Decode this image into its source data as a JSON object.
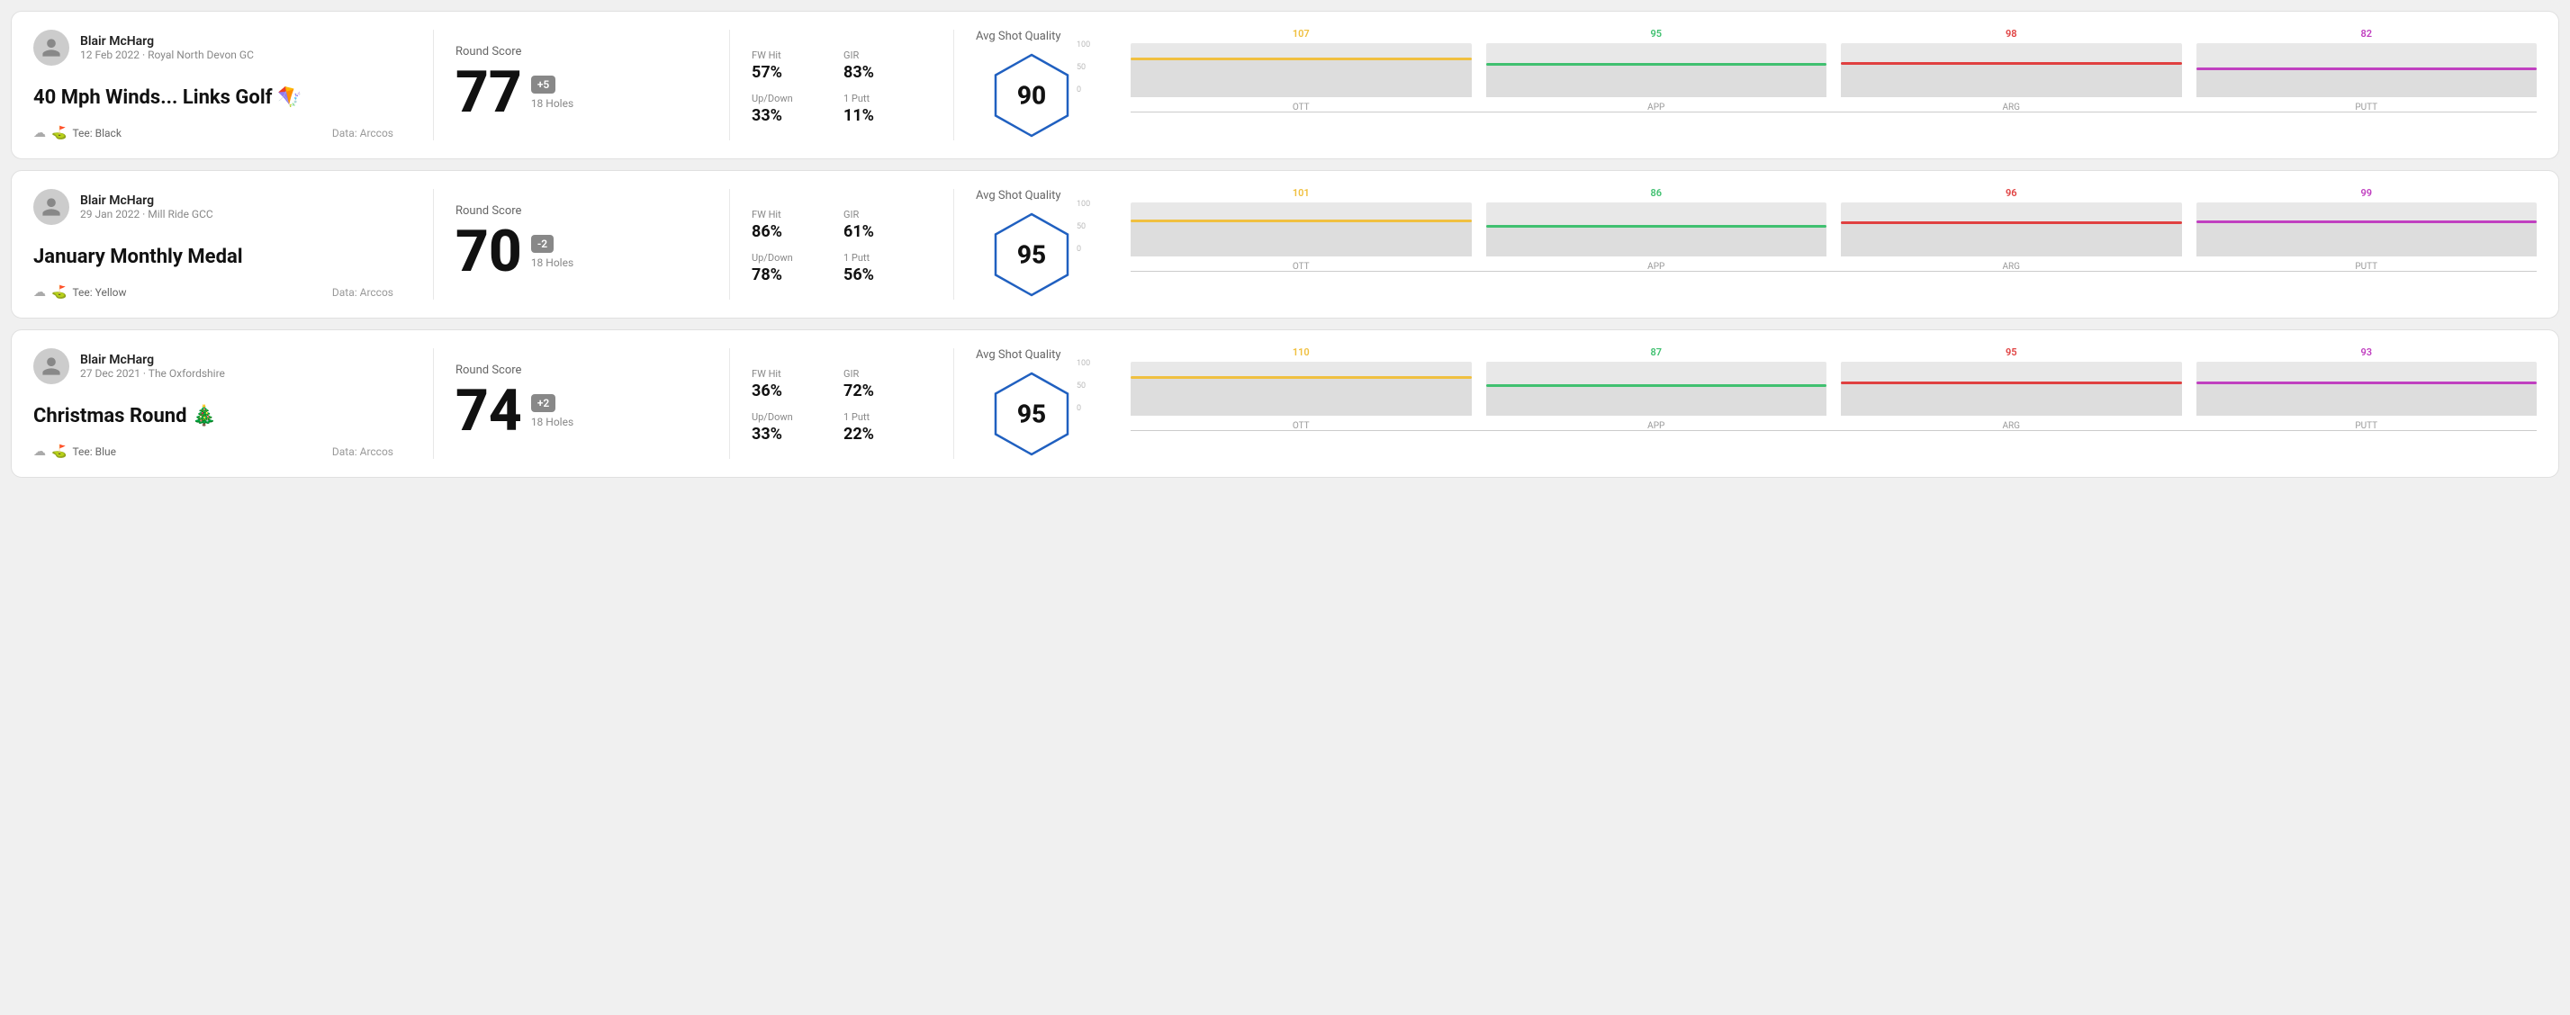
{
  "rounds": [
    {
      "id": "round-1",
      "user": {
        "name": "Blair McHarg",
        "date": "12 Feb 2022 · Royal North Devon GC"
      },
      "title": "40 Mph Winds... Links Golf 🪁",
      "tee": "Black",
      "dataSource": "Data: Arccos",
      "score": {
        "label": "Round Score",
        "value": "77",
        "badge": "+5",
        "badgeType": "positive",
        "holes": "18 Holes"
      },
      "stats": {
        "fwHitLabel": "FW Hit",
        "fwHitValue": "57%",
        "girLabel": "GIR",
        "girValue": "83%",
        "upDownLabel": "Up/Down",
        "upDownValue": "33%",
        "onePuttLabel": "1 Putt",
        "onePuttValue": "11%"
      },
      "quality": {
        "label": "Avg Shot Quality",
        "score": "90"
      },
      "chart": {
        "bars": [
          {
            "label": "OTT",
            "value": 107,
            "color": "#f0c040",
            "fillHeight": 72
          },
          {
            "label": "APP",
            "value": 95,
            "color": "#40c070",
            "fillHeight": 63
          },
          {
            "label": "ARG",
            "value": 98,
            "color": "#e04040",
            "fillHeight": 65
          },
          {
            "label": "PUTT",
            "value": 82,
            "color": "#c040c0",
            "fillHeight": 55
          }
        ],
        "yLabels": [
          "100",
          "50",
          "0"
        ]
      }
    },
    {
      "id": "round-2",
      "user": {
        "name": "Blair McHarg",
        "date": "29 Jan 2022 · Mill Ride GCC"
      },
      "title": "January Monthly Medal",
      "tee": "Yellow",
      "dataSource": "Data: Arccos",
      "score": {
        "label": "Round Score",
        "value": "70",
        "badge": "-2",
        "badgeType": "negative",
        "holes": "18 Holes"
      },
      "stats": {
        "fwHitLabel": "FW Hit",
        "fwHitValue": "86%",
        "girLabel": "GIR",
        "girValue": "61%",
        "upDownLabel": "Up/Down",
        "upDownValue": "78%",
        "onePuttLabel": "1 Putt",
        "onePuttValue": "56%"
      },
      "quality": {
        "label": "Avg Shot Quality",
        "score": "95"
      },
      "chart": {
        "bars": [
          {
            "label": "OTT",
            "value": 101,
            "color": "#f0c040",
            "fillHeight": 67
          },
          {
            "label": "APP",
            "value": 86,
            "color": "#40c070",
            "fillHeight": 57
          },
          {
            "label": "ARG",
            "value": 96,
            "color": "#e04040",
            "fillHeight": 64
          },
          {
            "label": "PUTT",
            "value": 99,
            "color": "#c040c0",
            "fillHeight": 66
          }
        ],
        "yLabels": [
          "100",
          "50",
          "0"
        ]
      }
    },
    {
      "id": "round-3",
      "user": {
        "name": "Blair McHarg",
        "date": "27 Dec 2021 · The Oxfordshire"
      },
      "title": "Christmas Round 🎄",
      "tee": "Blue",
      "dataSource": "Data: Arccos",
      "score": {
        "label": "Round Score",
        "value": "74",
        "badge": "+2",
        "badgeType": "positive",
        "holes": "18 Holes"
      },
      "stats": {
        "fwHitLabel": "FW Hit",
        "fwHitValue": "36%",
        "girLabel": "GIR",
        "girValue": "72%",
        "upDownLabel": "Up/Down",
        "upDownValue": "33%",
        "onePuttLabel": "1 Putt",
        "onePuttValue": "22%"
      },
      "quality": {
        "label": "Avg Shot Quality",
        "score": "95"
      },
      "chart": {
        "bars": [
          {
            "label": "OTT",
            "value": 110,
            "color": "#f0c040",
            "fillHeight": 73
          },
          {
            "label": "APP",
            "value": 87,
            "color": "#40c070",
            "fillHeight": 58
          },
          {
            "label": "ARG",
            "value": 95,
            "color": "#e04040",
            "fillHeight": 63
          },
          {
            "label": "PUTT",
            "value": 93,
            "color": "#c040c0",
            "fillHeight": 62
          }
        ],
        "yLabels": [
          "100",
          "50",
          "0"
        ]
      }
    }
  ]
}
